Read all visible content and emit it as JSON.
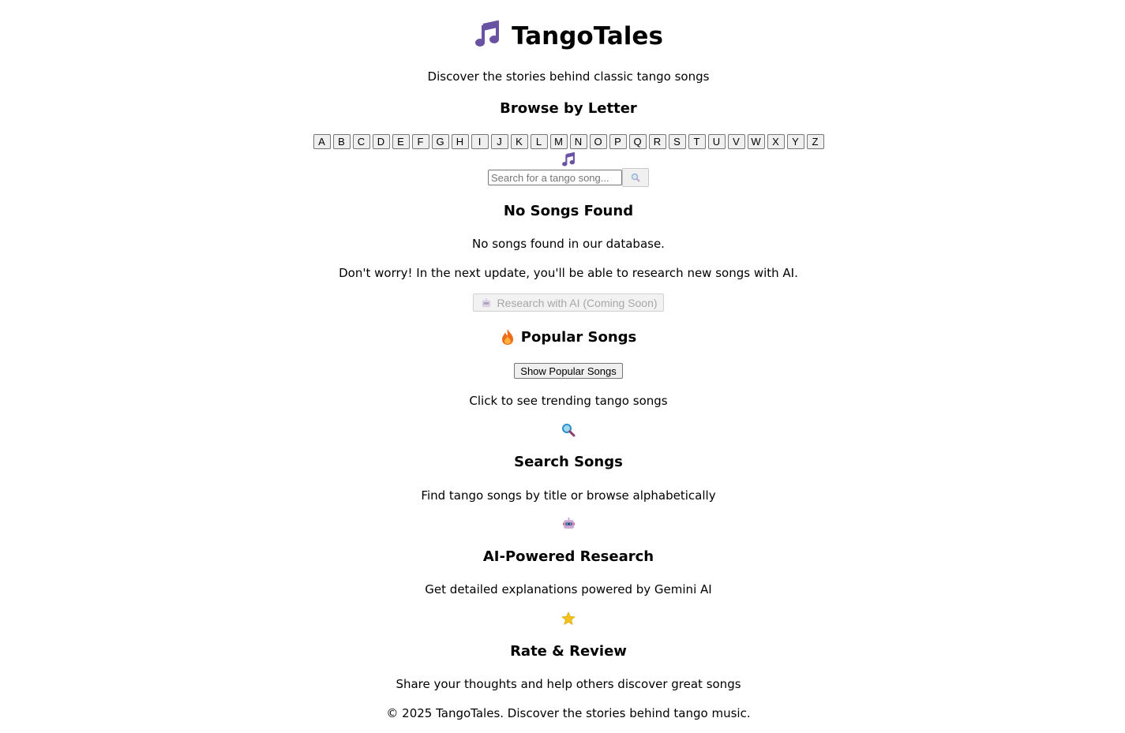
{
  "app": {
    "title": "TangoTales",
    "tagline": "Discover the stories behind classic tango songs"
  },
  "browse": {
    "heading": "Browse by Letter",
    "letters": [
      "A",
      "B",
      "C",
      "D",
      "E",
      "F",
      "G",
      "H",
      "I",
      "J",
      "K",
      "L",
      "M",
      "N",
      "O",
      "P",
      "Q",
      "R",
      "S",
      "T",
      "U",
      "V",
      "W",
      "X",
      "Y",
      "Z"
    ]
  },
  "search": {
    "placeholder": "Search for a tango song...",
    "button_icon": "magnifier-icon"
  },
  "results": {
    "heading": "No Songs Found",
    "message": "No songs found in our database.",
    "note": "Don't worry! In the next update, you'll be able to research new songs with AI.",
    "research_button": "Research with AI (Coming Soon)"
  },
  "popular": {
    "heading": "Popular Songs",
    "button": "Show Popular Songs",
    "caption": "Click to see trending tango songs"
  },
  "features": [
    {
      "icon": "magnifier-icon",
      "heading": "Search Songs",
      "text": "Find tango songs by title or browse alphabetically"
    },
    {
      "icon": "robot-icon",
      "heading": "AI-Powered Research",
      "text": "Get detailed explanations powered by Gemini AI"
    },
    {
      "icon": "star-icon",
      "heading": "Rate & Review",
      "text": "Share your thoughts and help others discover great songs"
    }
  ],
  "footer": {
    "text": "© 2025 TangoTales. Discover the stories behind tango music."
  },
  "colors": {
    "note": "#6a52a3",
    "flame": "#f06c1a",
    "star": "#f3c21c"
  }
}
